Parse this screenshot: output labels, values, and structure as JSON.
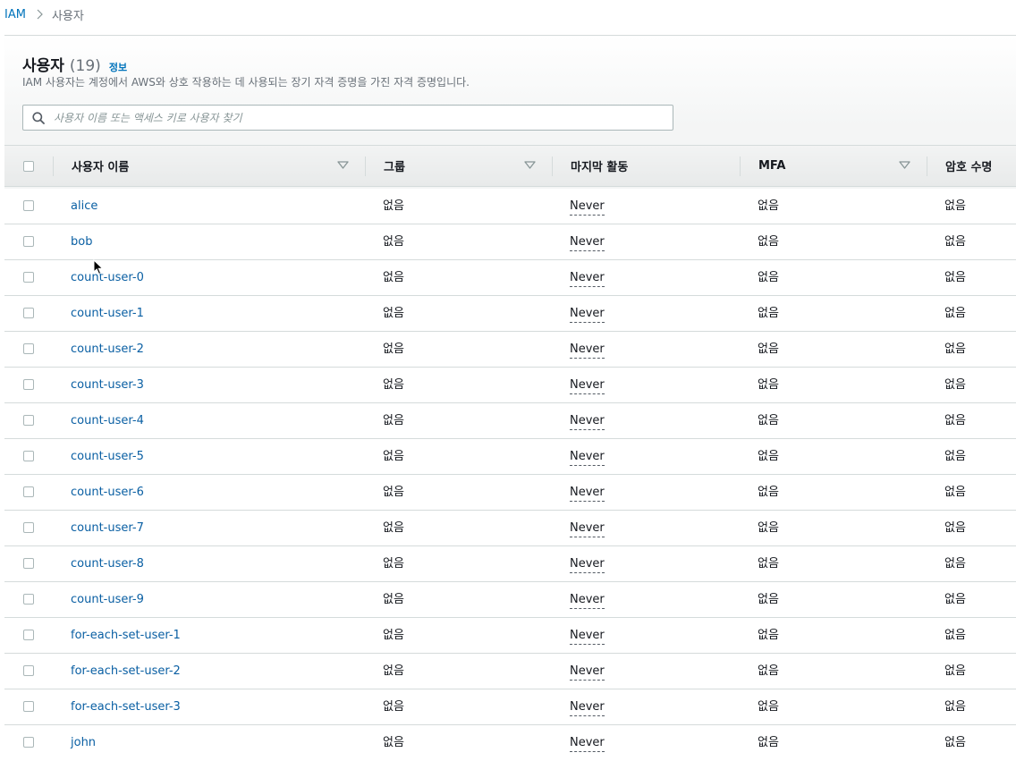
{
  "breadcrumb": {
    "root": "IAM",
    "current": "사용자"
  },
  "header": {
    "title": "사용자",
    "count": "(19)",
    "info": "정보",
    "description": "IAM 사용자는 계정에서 AWS와 상호 작용하는 데 사용되는 장기 자격 증명을 가진 자격 증명입니다."
  },
  "search": {
    "placeholder": "사용자 이름 또는 액세스 키로 사용자 찾기",
    "value": ""
  },
  "table": {
    "columns": {
      "username": "사용자 이름",
      "groups": "그룹",
      "last_activity": "마지막 활동",
      "mfa": "MFA",
      "password_age": "암호 수명"
    },
    "rows": [
      {
        "username": "alice",
        "groups": "없음",
        "last_activity": "Never",
        "mfa": "없음",
        "password_age": "없음"
      },
      {
        "username": "bob",
        "groups": "없음",
        "last_activity": "Never",
        "mfa": "없음",
        "password_age": "없음"
      },
      {
        "username": "count-user-0",
        "groups": "없음",
        "last_activity": "Never",
        "mfa": "없음",
        "password_age": "없음"
      },
      {
        "username": "count-user-1",
        "groups": "없음",
        "last_activity": "Never",
        "mfa": "없음",
        "password_age": "없음"
      },
      {
        "username": "count-user-2",
        "groups": "없음",
        "last_activity": "Never",
        "mfa": "없음",
        "password_age": "없음"
      },
      {
        "username": "count-user-3",
        "groups": "없음",
        "last_activity": "Never",
        "mfa": "없음",
        "password_age": "없음"
      },
      {
        "username": "count-user-4",
        "groups": "없음",
        "last_activity": "Never",
        "mfa": "없음",
        "password_age": "없음"
      },
      {
        "username": "count-user-5",
        "groups": "없음",
        "last_activity": "Never",
        "mfa": "없음",
        "password_age": "없음"
      },
      {
        "username": "count-user-6",
        "groups": "없음",
        "last_activity": "Never",
        "mfa": "없음",
        "password_age": "없음"
      },
      {
        "username": "count-user-7",
        "groups": "없음",
        "last_activity": "Never",
        "mfa": "없음",
        "password_age": "없음"
      },
      {
        "username": "count-user-8",
        "groups": "없음",
        "last_activity": "Never",
        "mfa": "없음",
        "password_age": "없음"
      },
      {
        "username": "count-user-9",
        "groups": "없음",
        "last_activity": "Never",
        "mfa": "없음",
        "password_age": "없음"
      },
      {
        "username": "for-each-set-user-1",
        "groups": "없음",
        "last_activity": "Never",
        "mfa": "없음",
        "password_age": "없음"
      },
      {
        "username": "for-each-set-user-2",
        "groups": "없음",
        "last_activity": "Never",
        "mfa": "없음",
        "password_age": "없음"
      },
      {
        "username": "for-each-set-user-3",
        "groups": "없음",
        "last_activity": "Never",
        "mfa": "없음",
        "password_age": "없음"
      },
      {
        "username": "john",
        "groups": "없음",
        "last_activity": "Never",
        "mfa": "없음",
        "password_age": "없음"
      }
    ]
  },
  "colors": {
    "link": "#0073bb",
    "user_link": "#0a5fa3",
    "border": "#d5dbdb",
    "muted_text": "#687078"
  },
  "icons": {
    "search": "search-icon",
    "sort": "caret-down-icon",
    "breadcrumb_separator": "chevron-right-icon",
    "cursor": "mouse-pointer-icon"
  }
}
